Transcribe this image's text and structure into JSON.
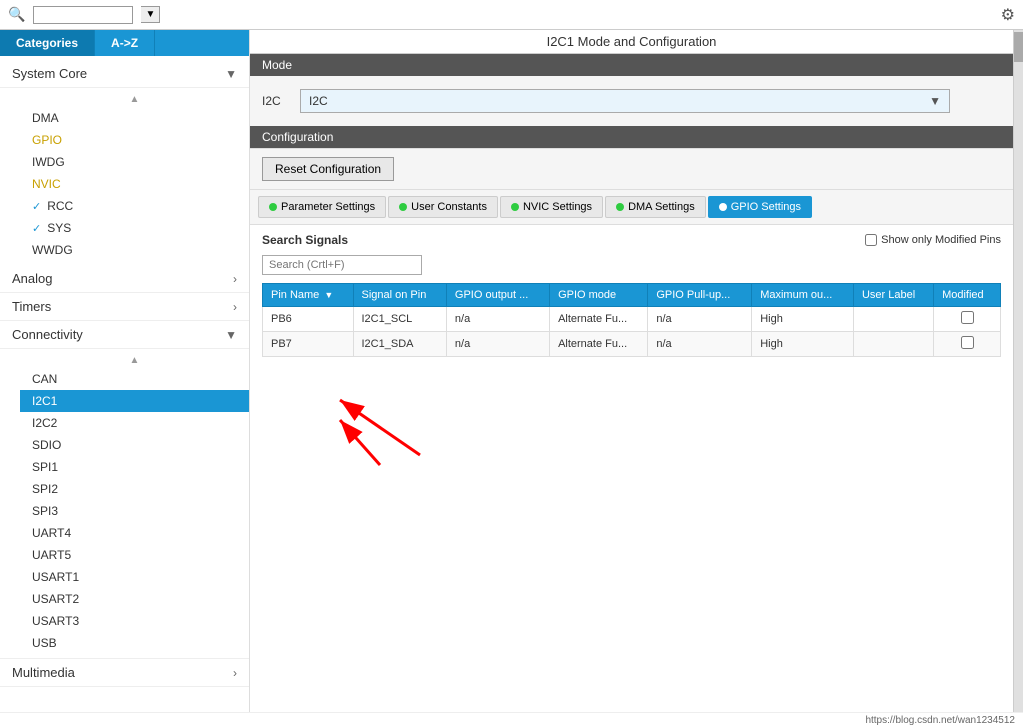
{
  "topbar": {
    "search_placeholder": "",
    "gear_icon": "⚙"
  },
  "sidebar": {
    "tab_categories": "Categories",
    "tab_atoz": "A->Z",
    "system_core": {
      "label": "System Core",
      "items": [
        {
          "label": "DMA",
          "style": "normal",
          "checked": false
        },
        {
          "label": "GPIO",
          "style": "yellow",
          "checked": false
        },
        {
          "label": "IWDG",
          "style": "normal",
          "checked": false
        },
        {
          "label": "NVIC",
          "style": "yellow",
          "checked": false
        },
        {
          "label": "RCC",
          "style": "normal",
          "checked": true
        },
        {
          "label": "SYS",
          "style": "normal",
          "checked": true
        },
        {
          "label": "WWDG",
          "style": "normal",
          "checked": false
        }
      ]
    },
    "analog": {
      "label": "Analog"
    },
    "timers": {
      "label": "Timers"
    },
    "connectivity": {
      "label": "Connectivity",
      "items": [
        {
          "label": "CAN",
          "active": false
        },
        {
          "label": "I2C1",
          "active": true
        },
        {
          "label": "I2C2",
          "active": false
        },
        {
          "label": "SDIO",
          "active": false
        },
        {
          "label": "SPI1",
          "active": false
        },
        {
          "label": "SPI2",
          "active": false
        },
        {
          "label": "SPI3",
          "active": false
        },
        {
          "label": "UART4",
          "active": false
        },
        {
          "label": "UART5",
          "active": false
        },
        {
          "label": "USART1",
          "active": false
        },
        {
          "label": "USART2",
          "active": false
        },
        {
          "label": "USART3",
          "active": false
        },
        {
          "label": "USB",
          "active": false
        }
      ]
    },
    "multimedia": {
      "label": "Multimedia"
    }
  },
  "content": {
    "title": "I2C1 Mode and Configuration",
    "mode_section": {
      "header": "Mode",
      "i2c_label": "I2C",
      "i2c_value": "I2C"
    },
    "config_section": {
      "header": "Configuration",
      "reset_button": "Reset Configuration",
      "tabs": [
        {
          "label": "Parameter Settings",
          "dot_color": "green",
          "active": false
        },
        {
          "label": "User Constants",
          "dot_color": "green",
          "active": false
        },
        {
          "label": "NVIC Settings",
          "dot_color": "green",
          "active": false
        },
        {
          "label": "DMA Settings",
          "dot_color": "green",
          "active": false
        },
        {
          "label": "GPIO Settings",
          "dot_color": "yellow",
          "active": true
        }
      ],
      "search_signals_label": "Search Signals",
      "search_placeholder": "Search (Crtl+F)",
      "show_modified_label": "Show only Modified Pins",
      "table": {
        "columns": [
          "Pin Name",
          "Signal on Pin",
          "GPIO output ...",
          "GPIO mode",
          "GPIO Pull-up...",
          "Maximum ou...",
          "User Label",
          "Modified"
        ],
        "rows": [
          [
            "PB6",
            "I2C1_SCL",
            "n/a",
            "Alternate Fu...",
            "n/a",
            "High",
            "",
            ""
          ],
          [
            "PB7",
            "I2C1_SDA",
            "n/a",
            "Alternate Fu...",
            "n/a",
            "High",
            "",
            ""
          ]
        ]
      }
    }
  },
  "bottom_url": "https://blog.csdn.net/wan1234512"
}
